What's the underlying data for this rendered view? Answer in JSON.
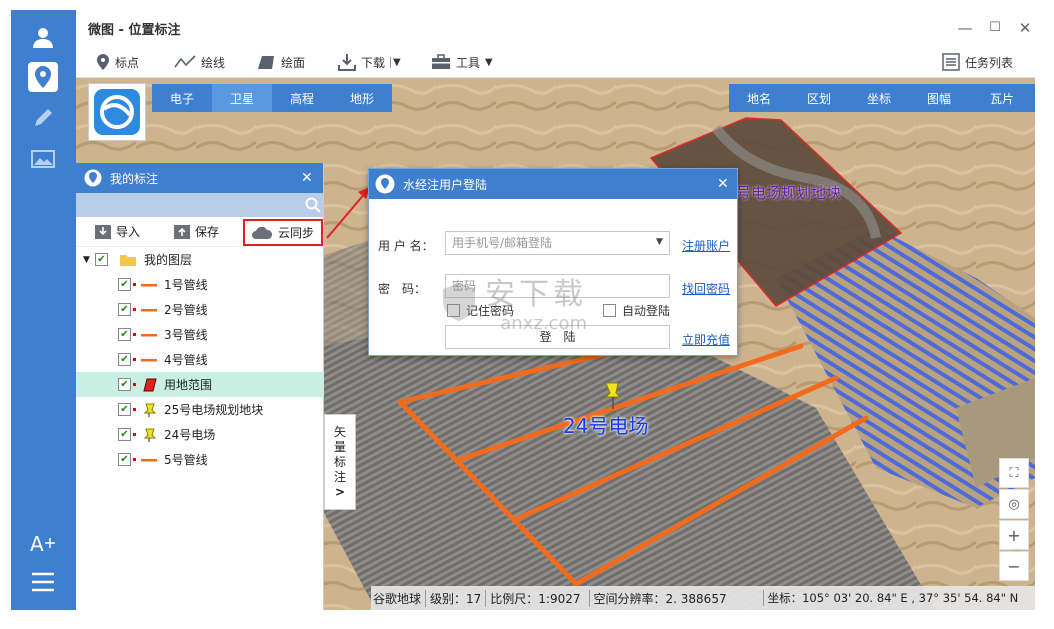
{
  "window": {
    "title": "微图 - 位置标注",
    "minimize_icon": "minimize-icon",
    "maximize_icon": "maximize-icon",
    "close_icon": "close-icon"
  },
  "toolbar": {
    "items": [
      {
        "label": "标点",
        "icon": "pin-icon"
      },
      {
        "label": "绘线",
        "icon": "polyline-icon"
      },
      {
        "label": "绘面",
        "icon": "polygon-icon"
      },
      {
        "label": "下载",
        "icon": "download-icon"
      },
      {
        "label": "工具",
        "icon": "toolbox-icon"
      }
    ],
    "task_list": "任务列表"
  },
  "map": {
    "left_tabs": [
      "电子",
      "卫星",
      "高程",
      "地形"
    ],
    "active_left_tab": "卫星",
    "right_tabs": [
      "地名",
      "区划",
      "坐标",
      "图幅",
      "瓦片"
    ],
    "label_plot": "号电场规划地块",
    "label_station": "24号电场",
    "vector_tab": [
      "矢",
      "量",
      "标",
      "注",
      ">"
    ]
  },
  "panel": {
    "title": "我的标注",
    "buttons": {
      "import": "导入",
      "save": "保存",
      "cloud": "云同步"
    },
    "root": "我的图层",
    "items": [
      {
        "label": "1号管线",
        "type": "line"
      },
      {
        "label": "2号管线",
        "type": "line"
      },
      {
        "label": "3号管线",
        "type": "line"
      },
      {
        "label": "4号管线",
        "type": "line"
      },
      {
        "label": "用地范围",
        "type": "area"
      },
      {
        "label": "25号电场规划地块",
        "type": "pin"
      },
      {
        "label": "24号电场",
        "type": "pin"
      },
      {
        "label": "5号管线",
        "type": "line"
      }
    ],
    "selected": "用地范围"
  },
  "dialog": {
    "title": "水经注用户登陆",
    "username_label": "用 户 名：",
    "username_placeholder": "用手机号/邮箱登陆",
    "register": "注册账户",
    "password_label": "密　码：",
    "password_placeholder": "密码",
    "forgot": "找回密码",
    "remember": "记住密码",
    "autologin": "自动登陆",
    "login_button": "登　陆",
    "recharge": "立即充值"
  },
  "status": {
    "source": "谷歌地球",
    "level": "级别：17",
    "scale": "比例尺：1:9027",
    "resolution": "空间分辨率：2. 388657",
    "coords": "坐标：105° 03' 20. 84\" E , 37° 35' 54. 84\" N"
  },
  "watermark": {
    "text": "安下载",
    "sub": "anxz.com"
  },
  "colors": {
    "accent": "#3f7fcf",
    "pipeline": "#f26b1d",
    "highlight": "#c9efe3",
    "annotation_red": "#e02020"
  }
}
